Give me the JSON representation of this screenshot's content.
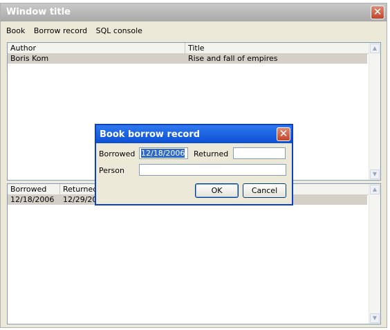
{
  "window": {
    "title": "Window title"
  },
  "menu": [
    {
      "label": "Book"
    },
    {
      "label": "Borrow record"
    },
    {
      "label": "SQL console"
    }
  ],
  "books_table": {
    "columns": [
      "Author",
      "Title"
    ],
    "rows": [
      {
        "author": "Boris Kom",
        "title": "Rise and fall of empires"
      }
    ]
  },
  "records_table": {
    "columns": [
      "Borrowed",
      "Returned"
    ],
    "rows": [
      {
        "borrowed": "12/18/2006",
        "returned": "12/29/20"
      }
    ]
  },
  "dialog": {
    "title": "Book borrow record",
    "borrowed_label": "Borrowed",
    "borrowed_value": "12/18/2006",
    "returned_label": "Returned",
    "returned_value": "",
    "person_label": "Person",
    "person_value": "",
    "ok_label": "OK",
    "cancel_label": "Cancel"
  },
  "icons": {
    "close": "close-icon",
    "scroll_up": "scroll-up-arrow",
    "scroll_down": "scroll-down-arrow"
  },
  "colors": {
    "dialog_titlebar": "#0b4fd4",
    "close_button": "#c2452a",
    "selection": "#316ac5"
  }
}
